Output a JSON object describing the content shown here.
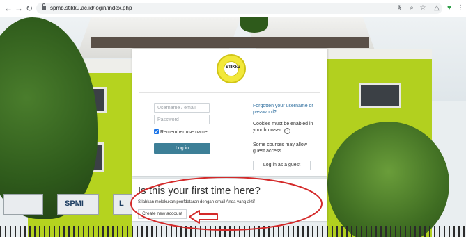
{
  "browser": {
    "url": "spmb.stikku.ac.id/login/index.php",
    "back_glyph": "←",
    "forward_glyph": "→",
    "reload_glyph": "↻",
    "key_glyph": "⚷",
    "zoom_glyph": "⌕",
    "star_glyph": "☆",
    "alert_glyph": "△",
    "shield_glyph": "♥",
    "menu_glyph": "⋮"
  },
  "background_signs": {
    "spmi": "SPMI",
    "partial_letter": "L"
  },
  "logo": {
    "mark_text": "STIKku"
  },
  "login_form": {
    "username_placeholder": "Username / email",
    "password_placeholder": "Password",
    "remember_label": "Remember username",
    "login_button": "Log in"
  },
  "side_info": {
    "forgot_link": "Forgotten your username or password?",
    "cookies_text": "Cookies must be enabled in your browser",
    "help_glyph": "?",
    "guest_text": "Some courses may allow guest access",
    "guest_button": "Log in as a guest"
  },
  "signup": {
    "heading": "Is this your first time here?",
    "info": "Silahkan melakukan penfdataran dengan email Anda yang aktif",
    "create_button": "Create new account"
  },
  "colors": {
    "login_button_bg": "#3d7f97",
    "annotation_red": "#d42a2a",
    "link": "#2f6f9f"
  }
}
